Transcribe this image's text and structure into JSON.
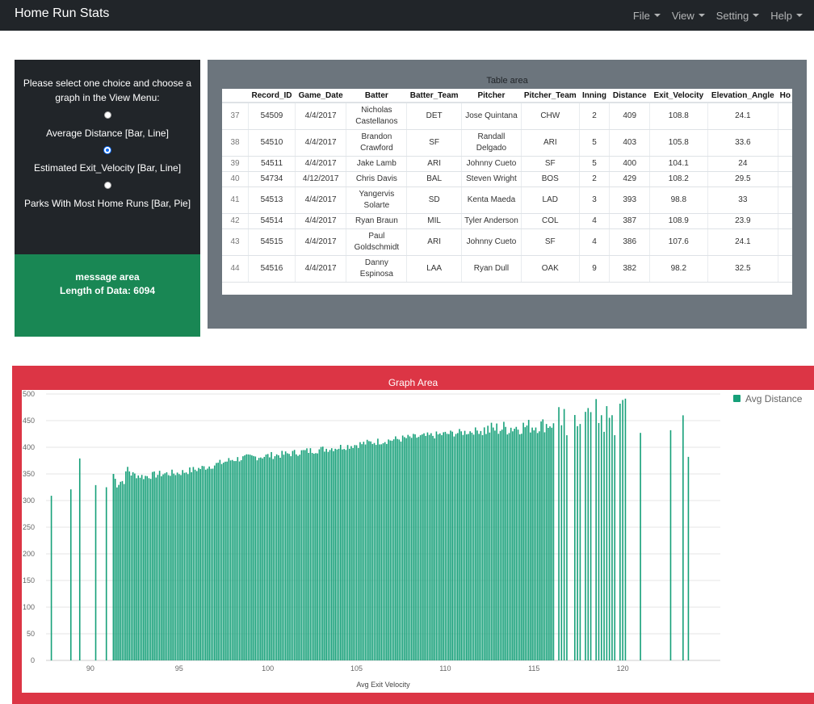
{
  "app": {
    "title": "Home Run Stats"
  },
  "menu": [
    "File",
    "View",
    "Setting",
    "Help"
  ],
  "choices": {
    "prompt": "Please select one choice and choose a graph in the View Menu:",
    "options": [
      {
        "label": "Average Distance [Bar, Line]",
        "selected": false
      },
      {
        "label": "Estimated Exit_Velocity [Bar, Line]",
        "selected": true
      },
      {
        "label": "Parks With Most Home Runs [Bar, Pie]",
        "selected": false
      }
    ]
  },
  "message": {
    "title": "message area",
    "text": "Length of Data: 6094"
  },
  "table": {
    "title": "Table area",
    "columns": [
      "",
      "Record_ID",
      "Game_Date",
      "Batter",
      "Batter_Team",
      "Pitcher",
      "Pitcher_Team",
      "Inning",
      "Distance",
      "Exit_Velocity",
      "Elevation_Angle",
      "Ho"
    ],
    "rows": [
      [
        "37",
        "54509",
        "4/4/2017",
        "Nicholas Castellanos",
        "DET",
        "Jose Quintana",
        "CHW",
        "2",
        "409",
        "108.8",
        "24.1",
        ""
      ],
      [
        "38",
        "54510",
        "4/4/2017",
        "Brandon Crawford",
        "SF",
        "Randall Delgado",
        "ARI",
        "5",
        "403",
        "105.8",
        "33.6",
        ""
      ],
      [
        "39",
        "54511",
        "4/4/2017",
        "Jake Lamb",
        "ARI",
        "Johnny Cueto",
        "SF",
        "5",
        "400",
        "104.1",
        "24",
        ""
      ],
      [
        "40",
        "54734",
        "4/12/2017",
        "Chris Davis",
        "BAL",
        "Steven Wright",
        "BOS",
        "2",
        "429",
        "108.2",
        "29.5",
        ""
      ],
      [
        "41",
        "54513",
        "4/4/2017",
        "Yangervis Solarte",
        "SD",
        "Kenta Maeda",
        "LAD",
        "3",
        "393",
        "98.8",
        "33",
        ""
      ],
      [
        "42",
        "54514",
        "4/4/2017",
        "Ryan Braun",
        "MIL",
        "Tyler Anderson",
        "COL",
        "4",
        "387",
        "108.9",
        "23.9",
        ""
      ],
      [
        "43",
        "54515",
        "4/4/2017",
        "Paul Goldschmidt",
        "ARI",
        "Johnny Cueto",
        "SF",
        "4",
        "386",
        "107.6",
        "24.1",
        ""
      ],
      [
        "44",
        "54516",
        "4/4/2017",
        "Danny Espinosa",
        "LAA",
        "Ryan Dull",
        "OAK",
        "9",
        "382",
        "98.2",
        "32.5",
        ""
      ]
    ]
  },
  "graph": {
    "title": "Graph Area"
  },
  "chart_data": {
    "type": "bar",
    "xlabel": "Avg Exit Velocity",
    "ylabel": "",
    "xlim": [
      87.5,
      125.5
    ],
    "ylim": [
      0,
      500
    ],
    "xticks": [
      90,
      95,
      100,
      105,
      110,
      115,
      120
    ],
    "yticks": [
      0,
      50,
      100,
      150,
      200,
      250,
      300,
      350,
      400,
      450,
      500
    ],
    "grid": true,
    "legend": "top-right",
    "color": "#16a079",
    "series": [
      {
        "name": "Avg Distance"
      }
    ],
    "anchors": [
      [
        87.8,
        309
      ],
      [
        88.9,
        321
      ],
      [
        89.4,
        379
      ],
      [
        90.3,
        329
      ],
      [
        90.9,
        325
      ],
      [
        91.3,
        350
      ],
      [
        91.5,
        330
      ],
      [
        91.7,
        336
      ],
      [
        91.9,
        337
      ],
      [
        92.1,
        362
      ],
      [
        92.3,
        350
      ],
      [
        93,
        345
      ],
      [
        94,
        350
      ],
      [
        95,
        352
      ],
      [
        96,
        359
      ],
      [
        97,
        367
      ],
      [
        98,
        377
      ],
      [
        99,
        381
      ],
      [
        100,
        384
      ],
      [
        101,
        387
      ],
      [
        102,
        392
      ],
      [
        103,
        396
      ],
      [
        104,
        400
      ],
      [
        105,
        405
      ],
      [
        106,
        410
      ],
      [
        107,
        414
      ],
      [
        108,
        418
      ],
      [
        109,
        421
      ],
      [
        110,
        425
      ],
      [
        111,
        428
      ],
      [
        112,
        432
      ],
      [
        113,
        435
      ],
      [
        114,
        438
      ],
      [
        115,
        440
      ],
      [
        115.8,
        443
      ],
      [
        116.6,
        450
      ],
      [
        117.4,
        455
      ],
      [
        118.2,
        460
      ],
      [
        119,
        455
      ],
      [
        119.8,
        450
      ],
      [
        120.2,
        468
      ],
      [
        121,
        427
      ],
      [
        122.7,
        432
      ],
      [
        123.4,
        460
      ],
      [
        123.7,
        382
      ]
    ],
    "sparse_from": 120.5
  }
}
